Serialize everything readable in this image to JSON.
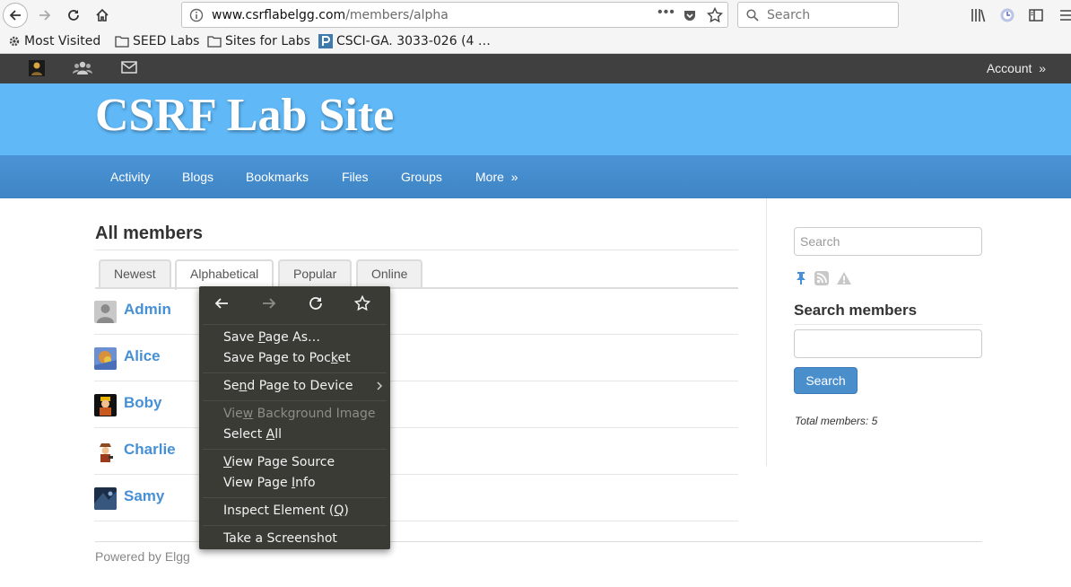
{
  "browser": {
    "url_domain": "www.csrflabelgg.com",
    "url_path": "/members/alpha",
    "page_actions": "•••",
    "search_placeholder": "Search",
    "bookmarks": [
      "Most Visited",
      "SEED Labs",
      "Sites for Labs",
      "CSCI-GA. 3033-026 (4 …"
    ]
  },
  "topbar": {
    "account_label": "Account",
    "account_arrow": "»"
  },
  "site": {
    "title": "CSRF Lab Site"
  },
  "menu": {
    "items": [
      "Activity",
      "Blogs",
      "Bookmarks",
      "Files",
      "Groups",
      "More"
    ],
    "more_arrow": "»"
  },
  "main": {
    "title": "All members",
    "tabs": [
      "Newest",
      "Alphabetical",
      "Popular",
      "Online"
    ],
    "members": [
      "Admin",
      "Alice",
      "Boby",
      "Charlie",
      "Samy"
    ]
  },
  "sidebar": {
    "search_placeholder": "Search",
    "heading": "Search members",
    "button_label": "Search",
    "total_label": "Total members: 5"
  },
  "footer": {
    "powered_by": "Powered by Elgg"
  },
  "context_menu": {
    "save_page_as": [
      "Save ",
      "P",
      "age As…"
    ],
    "save_to_pocket": [
      "Save Page to Poc",
      "k",
      "et"
    ],
    "send_to_device": [
      "Se",
      "n",
      "d Page to Device"
    ],
    "view_background": [
      "Vie",
      "w",
      " Background Image"
    ],
    "select_all": [
      "Select ",
      "A",
      "ll"
    ],
    "view_source": [
      "",
      "V",
      "iew Page Source"
    ],
    "view_info": [
      "View Page ",
      "I",
      "nfo"
    ],
    "inspect": [
      "Inspect Element (",
      "Q",
      ")"
    ],
    "screenshot": [
      "Take a Screenshot",
      "",
      ""
    ]
  }
}
